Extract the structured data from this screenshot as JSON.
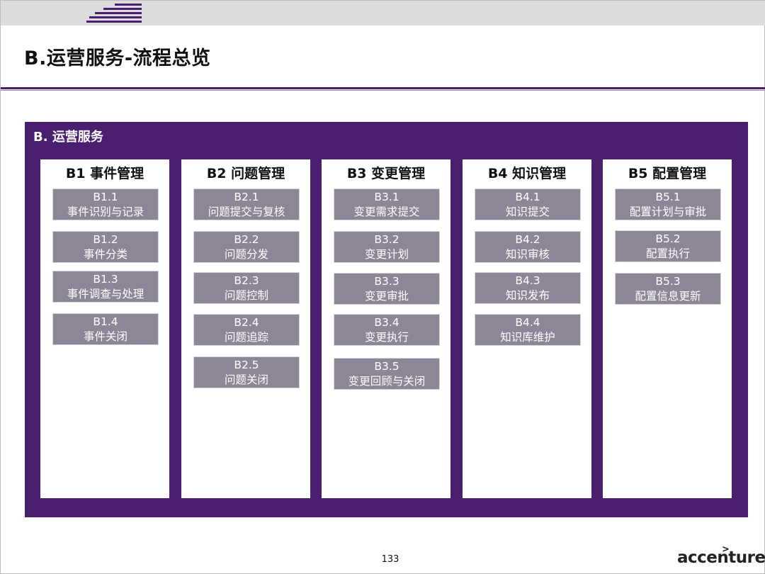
{
  "slide_title": "B.运营服务-流程总览",
  "panel_title": "B. 运营服务",
  "columns": [
    {
      "heading": "B1 事件管理",
      "items": [
        {
          "code": "B1.1",
          "name": "事件识别与记录"
        },
        {
          "code": "B1.2",
          "name": "事件分类"
        },
        {
          "code": "B1.3",
          "name": "事件调查与处理"
        },
        {
          "code": "B1.4",
          "name": "事件关闭"
        }
      ]
    },
    {
      "heading": "B2 问题管理",
      "items": [
        {
          "code": "B2.1",
          "name": "问题提交与复核"
        },
        {
          "code": "B2.2",
          "name": "问题分发"
        },
        {
          "code": "B2.3",
          "name": "问题控制"
        },
        {
          "code": "B2.4",
          "name": "问题追踪"
        },
        {
          "code": "B2.5",
          "name": "问题关闭"
        }
      ]
    },
    {
      "heading": "B3 变更管理",
      "items": [
        {
          "code": "B3.1",
          "name": "变更需求提交"
        },
        {
          "code": "B3.2",
          "name": "变更计划"
        },
        {
          "code": "B3.3",
          "name": "变更审批"
        },
        {
          "code": "B3.4",
          "name": "变更执行"
        },
        {
          "code": "B3.5",
          "name": "变更回顾与关闭"
        }
      ]
    },
    {
      "heading": "B4 知识管理",
      "items": [
        {
          "code": "B4.1",
          "name": "知识提交"
        },
        {
          "code": "B4.2",
          "name": "知识审核"
        },
        {
          "code": "B4.3",
          "name": "知识发布"
        },
        {
          "code": "B4.4",
          "name": "知识库维护"
        }
      ]
    },
    {
      "heading": "B5 配置管理",
      "items": [
        {
          "code": "B5.1",
          "name": "配置计划与审批"
        },
        {
          "code": "B5.2",
          "name": "配置执行"
        },
        {
          "code": "B5.3",
          "name": "配置信息更新"
        }
      ]
    }
  ],
  "page_number": "133",
  "brand": {
    "logo_text": "accenture",
    "logo_mark": ">",
    "accent_color": "#4b1f6f"
  }
}
